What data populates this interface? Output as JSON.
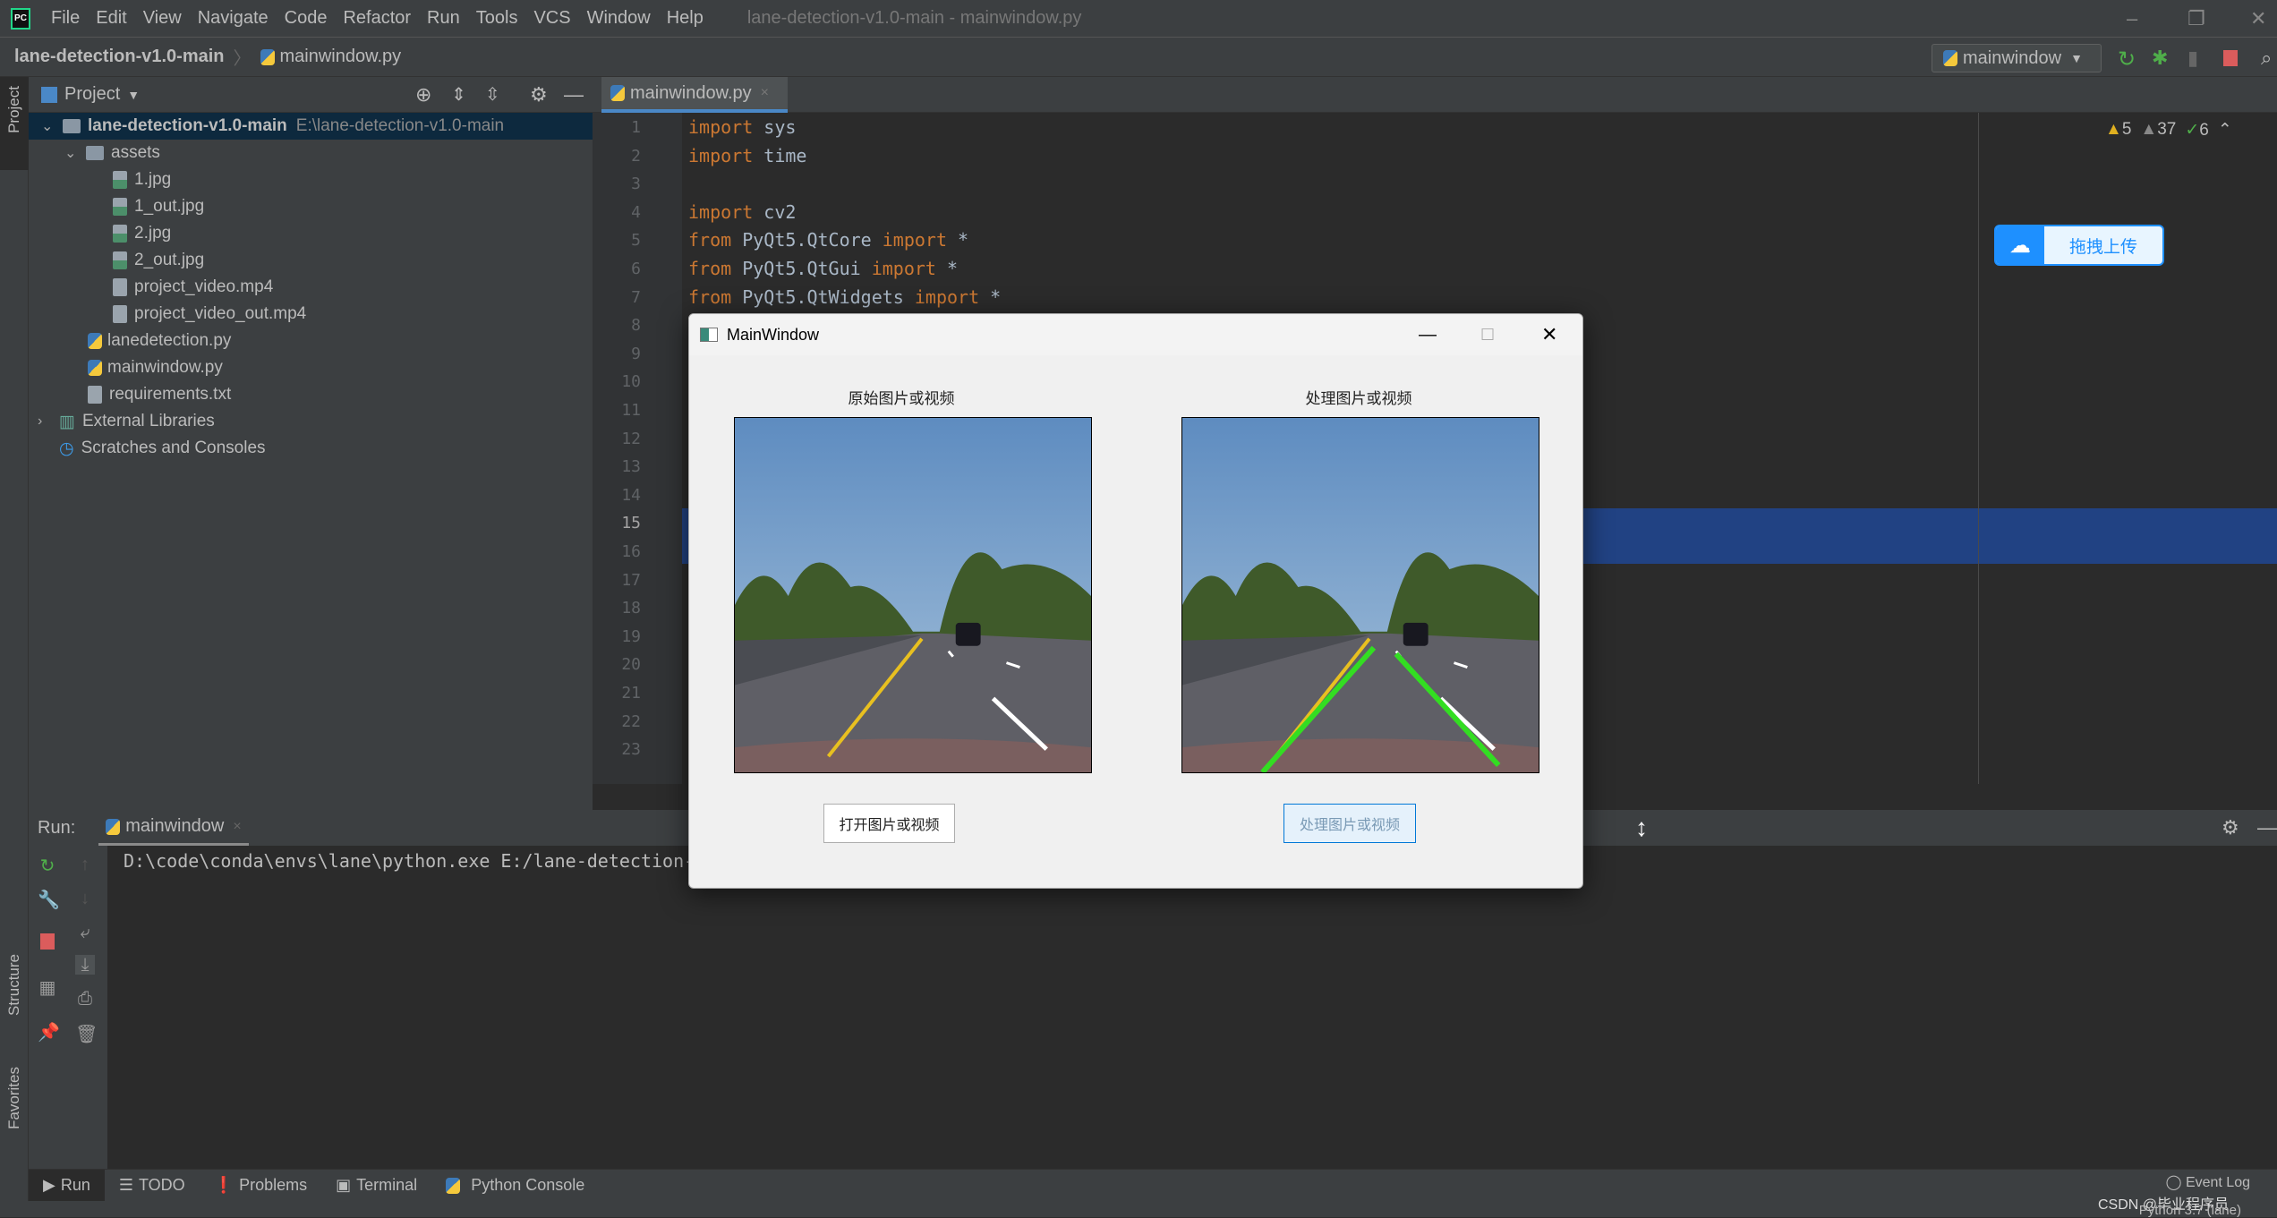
{
  "app": {
    "window_title": "lane-detection-v1.0-main - mainwindow.py",
    "menu": [
      "File",
      "Edit",
      "View",
      "Navigate",
      "Code",
      "Refactor",
      "Run",
      "Tools",
      "VCS",
      "Window",
      "Help"
    ]
  },
  "breadcrumb": {
    "project": "lane-detection-v1.0-main",
    "file": "mainwindow.py"
  },
  "toolbar": {
    "run_config": "mainwindow"
  },
  "sidebar": {
    "project_tab": "Project",
    "structure_tab": "Structure",
    "favorites_tab": "Favorites"
  },
  "project": {
    "title": "Project",
    "root": {
      "name": "lane-detection-v1.0-main",
      "path": "E:\\lane-detection-v1.0-main"
    },
    "items": [
      {
        "label": "assets",
        "type": "folder"
      },
      {
        "label": "1.jpg",
        "type": "image"
      },
      {
        "label": "1_out.jpg",
        "type": "image"
      },
      {
        "label": "2.jpg",
        "type": "image"
      },
      {
        "label": "2_out.jpg",
        "type": "image"
      },
      {
        "label": "project_video.mp4",
        "type": "unknown"
      },
      {
        "label": "project_video_out.mp4",
        "type": "unknown"
      },
      {
        "label": "lanedetection.py",
        "type": "python"
      },
      {
        "label": "mainwindow.py",
        "type": "python"
      },
      {
        "label": "requirements.txt",
        "type": "text"
      },
      {
        "label": "External Libraries",
        "type": "library"
      },
      {
        "label": "Scratches and Consoles",
        "type": "scratch"
      }
    ]
  },
  "editor": {
    "tab": "mainwindow.py",
    "current_line": "15",
    "lines": [
      [
        "import",
        " sys"
      ],
      [
        "import",
        " time"
      ],
      [
        "",
        ""
      ],
      [
        "import",
        " cv2"
      ],
      [
        "from",
        " PyQt5.QtCore ",
        "import",
        " *"
      ],
      [
        "from",
        " PyQt5.QtGui ",
        "import",
        " *"
      ],
      [
        "from",
        " PyQt5.QtWidgets ",
        "import",
        " *"
      ]
    ],
    "line_numbers": [
      "1",
      "2",
      "3",
      "4",
      "5",
      "6",
      "7",
      "8",
      "9",
      "10",
      "11",
      "12",
      "13",
      "14",
      "15",
      "16",
      "17",
      "18",
      "19",
      "20",
      "21",
      "22",
      "23"
    ],
    "inspections": {
      "warnings": "5",
      "weak_warnings": "37",
      "typos": "6"
    }
  },
  "baidu": {
    "label": "拖拽上传"
  },
  "run": {
    "label": "Run:",
    "tab": "mainwindow",
    "console": "D:\\code\\conda\\envs\\lane\\python.exe E:/lane-detection-"
  },
  "bottom_tabs": [
    "Run",
    "TODO",
    "Problems",
    "Terminal",
    "Python Console"
  ],
  "status": {
    "event_log": "Event Log",
    "watermark": "CSDN @毕业程序员",
    "interpreter": "Python 3.7 (lane)"
  },
  "dialog": {
    "title": "MainWindow",
    "left_label": "原始图片或视频",
    "right_label": "处理图片或视频",
    "open_button": "打开图片或视频",
    "process_button": "处理图片或视频"
  },
  "colors": {
    "keyword": "#cc7832",
    "selection": "#214283",
    "lane_detected": "#33dd22",
    "accent": "#4a88c7"
  }
}
